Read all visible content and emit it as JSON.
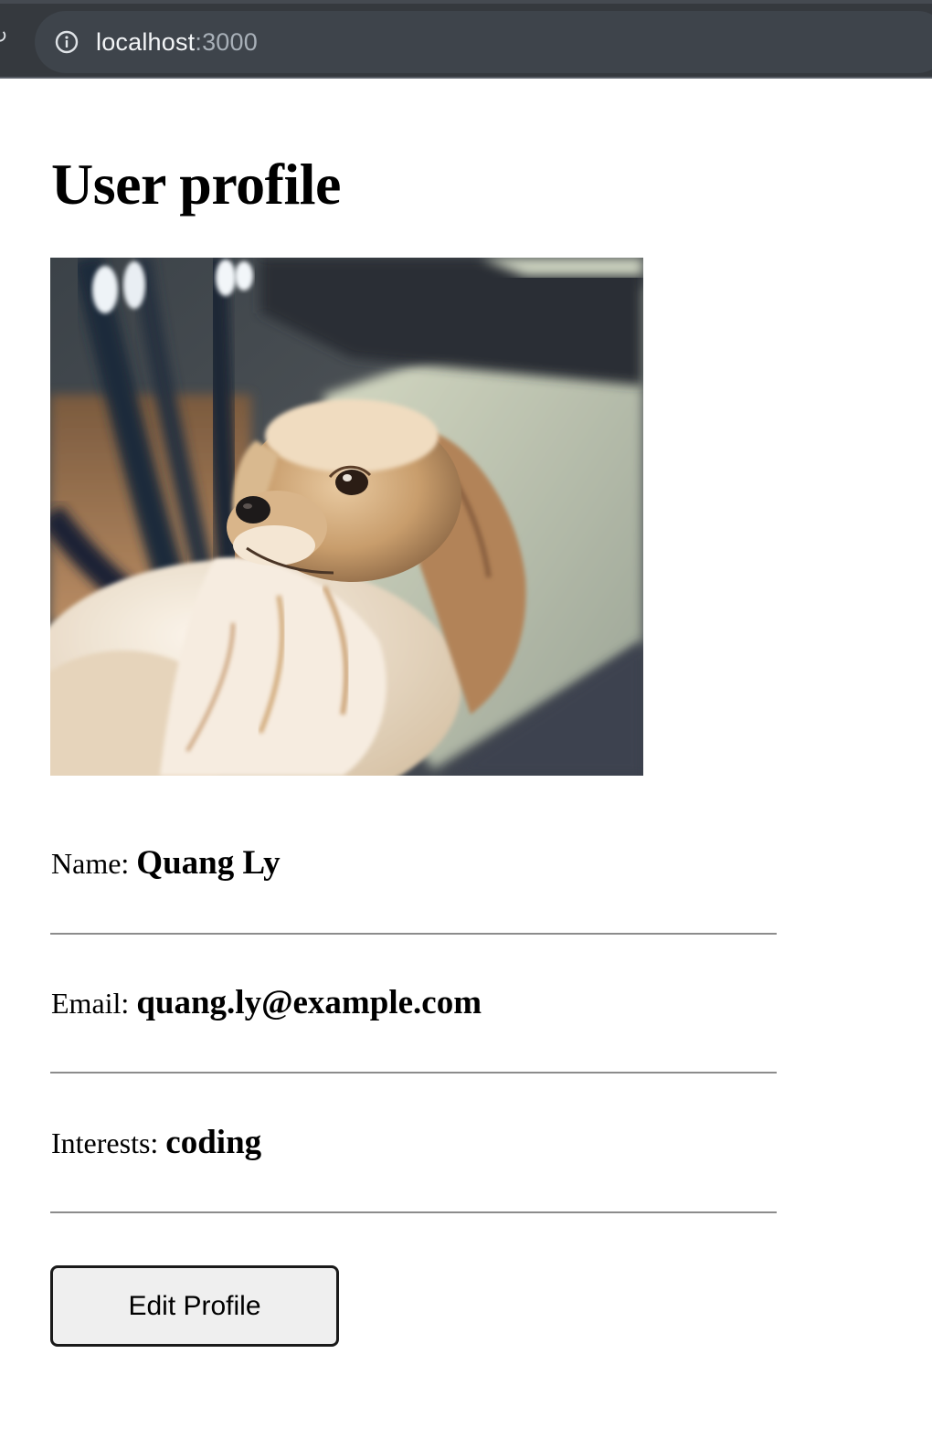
{
  "browser": {
    "url_host": "localhost",
    "url_port": ":3000"
  },
  "page": {
    "title": "User profile"
  },
  "profile": {
    "name_label": "Name:",
    "name_value": "Quang Ly",
    "email_label": "Email:",
    "email_value": "quang.ly@example.com",
    "interests_label": "Interests:",
    "interests_value": "coding"
  },
  "actions": {
    "edit_label": "Edit Profile"
  },
  "colors": {
    "browser_chrome": "#35393e",
    "address_bar": "#3e444b",
    "button_bg": "#efefef",
    "divider": "#8c8c8c"
  }
}
